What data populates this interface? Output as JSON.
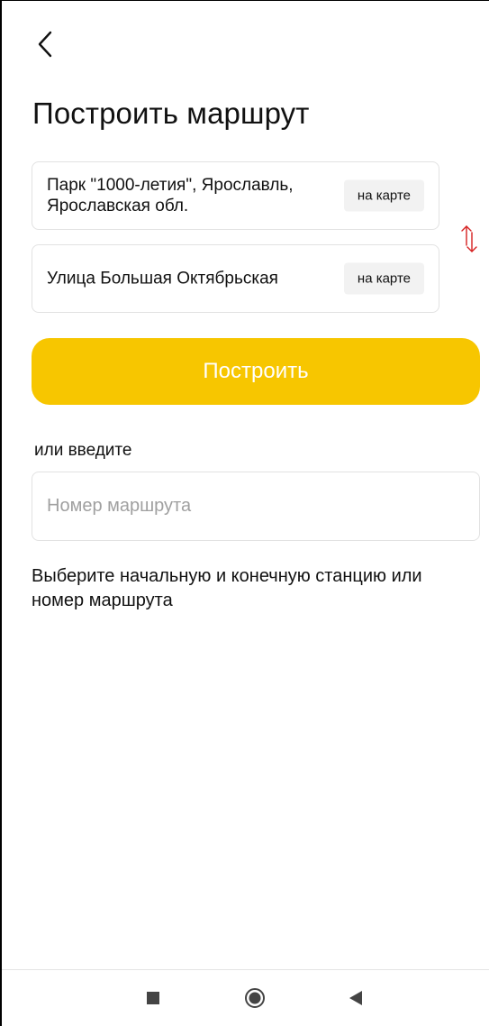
{
  "header": {
    "back_icon": "chevron-left-icon",
    "title": "Построить маршрут"
  },
  "route": {
    "from": {
      "text": "Парк \"1000-летия\", Ярославль, Ярославская обл.",
      "map_button": "на карте"
    },
    "to": {
      "text": "Улица Большая Октябрьская",
      "map_button": "на карте"
    },
    "swap_icon": "swap-vertical-arrows-icon",
    "swap_color": "#d62020"
  },
  "build_button": {
    "label": "Построить",
    "color": "#f7c600"
  },
  "route_number": {
    "or_label": "или введите",
    "placeholder": "Номер маршрута",
    "value": ""
  },
  "hint": "Выберите начальную и конечную станцию или номер маршрута",
  "system_nav": {
    "recents_icon": "square-icon",
    "home_icon": "circle-icon",
    "back_icon": "triangle-back-icon"
  }
}
